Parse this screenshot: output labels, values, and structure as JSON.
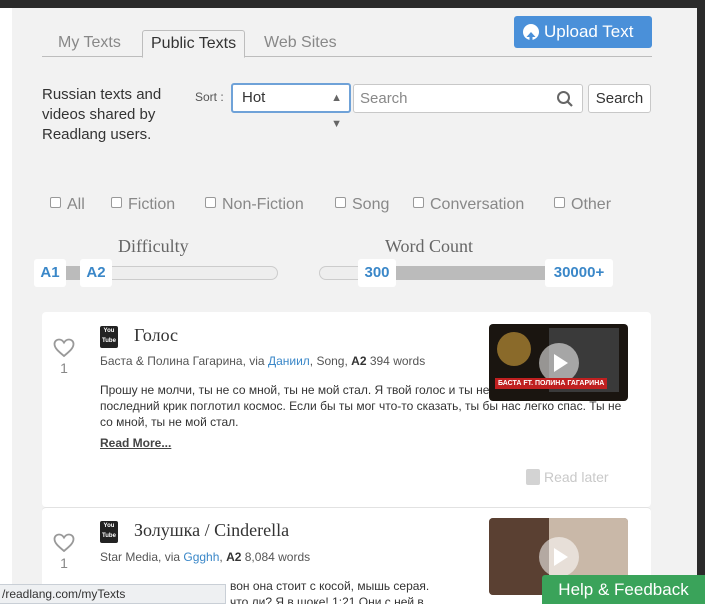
{
  "tabs": [
    {
      "label": "My Texts",
      "active": false
    },
    {
      "label": "Public Texts",
      "active": true
    },
    {
      "label": "Web Sites",
      "active": false
    }
  ],
  "upload_button": {
    "label": "Upload Text",
    "icon": "arrow-up-circle-icon"
  },
  "intro_text": "Russian texts and videos shared by Readlang users.",
  "sort": {
    "label": "Sort :",
    "selected": "Hot"
  },
  "search": {
    "placeholder": "Search",
    "button_label": "Search"
  },
  "filters": [
    "All",
    "Fiction",
    "Non-Fiction",
    "Song",
    "Conversation",
    "Other"
  ],
  "difficulty": {
    "title": "Difficulty",
    "min_label": "A1",
    "max_label": "A2"
  },
  "word_count": {
    "title": "Word Count",
    "min_label": "300",
    "max_label": "30000+"
  },
  "texts": [
    {
      "title": "Голос",
      "likes": "1",
      "author": "Баста & Полина Гагарина, via ",
      "user": "Даниил",
      "genre": ", Song, ",
      "level": "A2",
      "words": " 394 words",
      "excerpt": "Прошу не молчи, ты не со мной, ты не мой стал. Я твой голос и ты немой стал. И твой последний крик поглотил космос. Если бы ты мог что-то сказать, ты бы нас легко спас. Ты не со мной, ты не мой стал.",
      "read_more": "Read More...",
      "read_later": "Read later",
      "thumb_caption": "БАСТА FT. ПОЛИНА ГАГАРИНА"
    },
    {
      "title": "Золушка / Cinderella",
      "likes": "1",
      "author": "Star Media, via ",
      "user": "Ggghh",
      "genre": ", ",
      "level": "A2",
      "words": " 8,084 words",
      "excerpt_line1": "вон она стоит с косой, мышь серая.",
      "excerpt_line2": "что ли? Я в шоке! 1:21 Они с ней в"
    }
  ],
  "status_url": "/readlang.com/myTexts",
  "help_button": "Help & Feedback"
}
